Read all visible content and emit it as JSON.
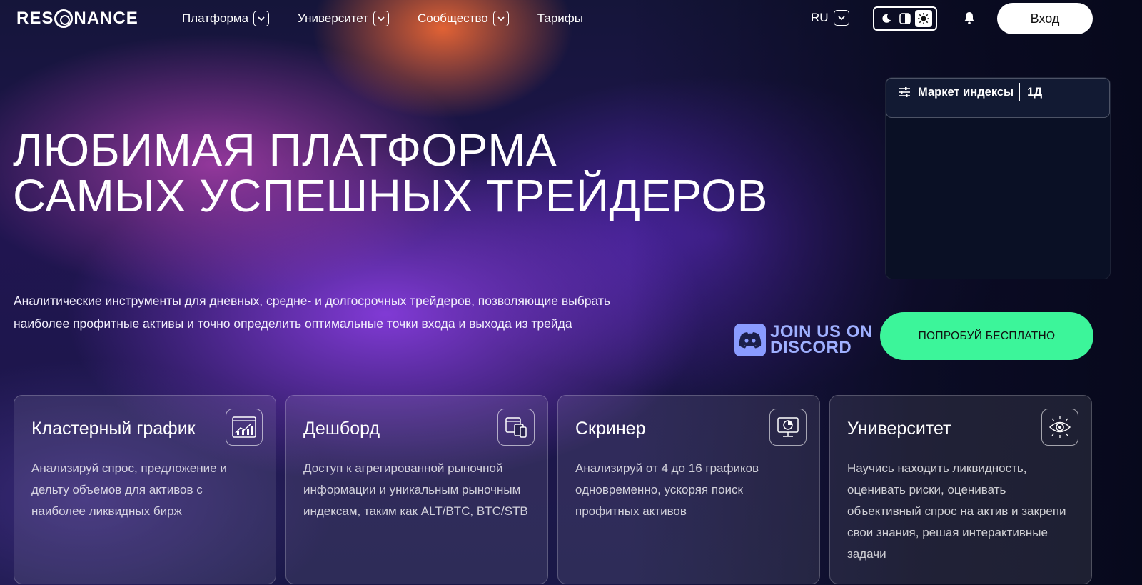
{
  "brand": {
    "logo_text_left": "RES",
    "logo_text_right": "NANCE"
  },
  "nav": {
    "items": [
      {
        "label": "Платформа",
        "has_dropdown": true
      },
      {
        "label": "Университет",
        "has_dropdown": true
      },
      {
        "label": "Сообщество",
        "has_dropdown": true
      },
      {
        "label": "Тарифы",
        "has_dropdown": false
      }
    ],
    "language": "RU",
    "theme_active": "light",
    "login_label": "Вход"
  },
  "hero": {
    "title_line1": "Любимая платформа",
    "title_line2": "самых успешных трейдеров",
    "subtitle": "Аналитические инструменты для дневных, средне- и долгосрочных трейдеров, позволяющие выбрать наиболее профитные активы и точно определить оптимальные точки входа и выхода из трейда"
  },
  "widget": {
    "title": "Маркет индексы",
    "period": "1Д"
  },
  "cta": {
    "discord_line1": "JOIN US ON",
    "discord_line2": "DISCORD",
    "try_free": "ПОПРОБУЙ БЕСПЛАТНО"
  },
  "cards": [
    {
      "title": "Кластерный график",
      "icon": "chart-icon",
      "text": "Анализируй спрос, предложение и дельту объемов для активов с наиболее ликвидных бирж"
    },
    {
      "title": "Дешборд",
      "icon": "dashboard-icon",
      "text": "Доступ к агрегированной рыночной информации и уникальным рыночным индексам, таким как ALT/BTC, BTC/STB"
    },
    {
      "title": "Скринер",
      "icon": "screener-icon",
      "text": "Анализируй от 4 до 16 графиков одновременно, ускоряя поиск профитных активов"
    },
    {
      "title": "Университет",
      "icon": "university-icon",
      "text": "Научись находить ликвидность, оценивать риски, оценивать объективный спрос на актив и закрепи свои знания, решая интерактивные задачи"
    }
  ],
  "colors": {
    "accent": "#3cf59a",
    "discord": "#8a9bff",
    "bg_dark": "#0b0f24"
  }
}
